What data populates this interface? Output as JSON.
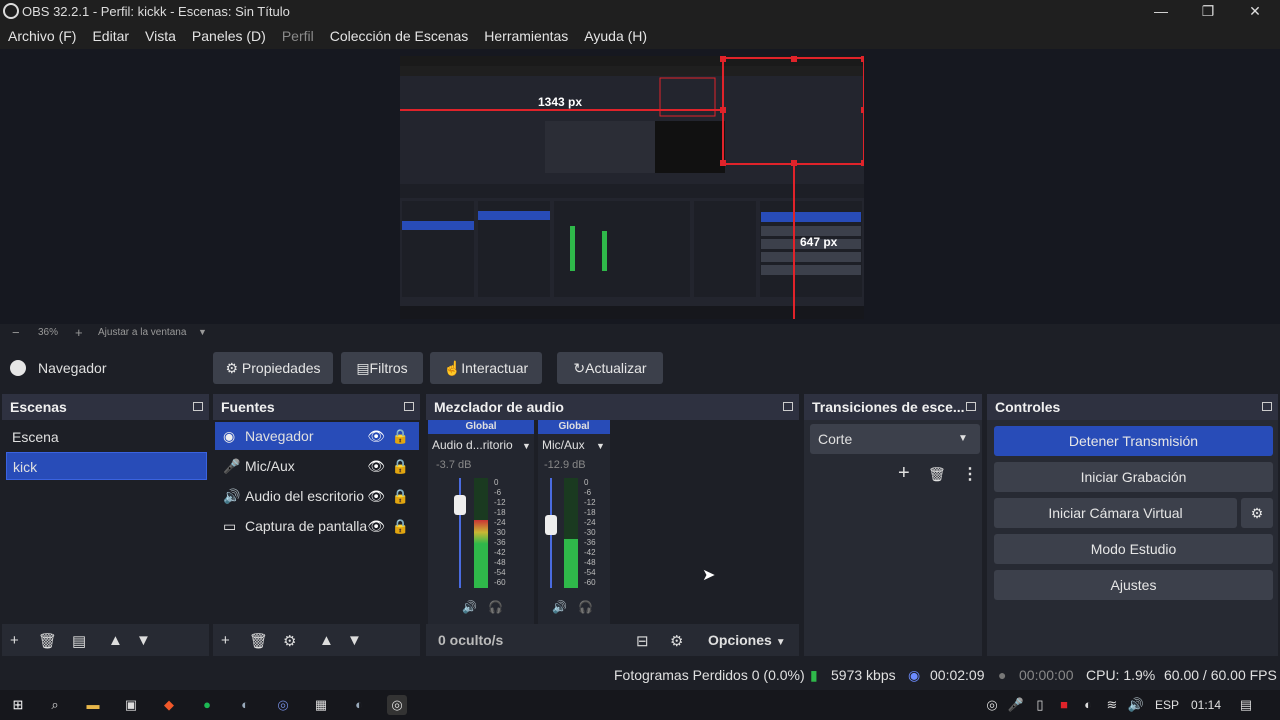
{
  "window": {
    "title": "OBS 32.2.1 - Perfil: kickk - Escenas: Sin Título"
  },
  "menu": [
    "Archivo (F)",
    "Editar",
    "Vista",
    "Paneles (D)",
    "Perfil",
    "Colección de Escenas",
    "Herramientas",
    "Ayuda (H)"
  ],
  "preview": {
    "zoom": "36%",
    "fit_label": "Ajustar a la ventana",
    "width_label": "1343 px",
    "height_label": "647 px"
  },
  "context": {
    "source_name": "Navegador",
    "buttons": {
      "properties": "Propiedades",
      "filters": "Filtros",
      "interact": "Interactuar",
      "refresh": "Actualizar"
    }
  },
  "scenes": {
    "title": "Escenas",
    "items": [
      "Escena",
      "kick"
    ]
  },
  "sources": {
    "title": "Fuentes",
    "items": [
      {
        "name": "Navegador",
        "icon": "globe-icon"
      },
      {
        "name": "Mic/Aux",
        "icon": "microphone-icon"
      },
      {
        "name": "Audio del escritorio",
        "icon": "speaker-icon"
      },
      {
        "name": "Captura de pantalla",
        "icon": "monitor-icon"
      }
    ]
  },
  "mixer": {
    "title": "Mezclador de audio",
    "channels": [
      {
        "tag": "Global",
        "name": "Audio d...ritorio",
        "db": "-3.7 dB",
        "level": 0.62,
        "fader": 0.75
      },
      {
        "tag": "Global",
        "name": "Mic/Aux",
        "db": "-12.9 dB",
        "level": 0.45,
        "fader": 0.55
      }
    ],
    "scale": [
      "0",
      "-6",
      "-12",
      "-18",
      "-24",
      "-30",
      "-36",
      "-42",
      "-48",
      "-54",
      "-60"
    ],
    "hidden": "0 oculto/s",
    "options": "Opciones"
  },
  "transitions": {
    "title": "Transiciones de esce...",
    "selected": "Corte"
  },
  "controls": {
    "title": "Controles",
    "stop_stream": "Detener Transmisión",
    "start_recording": "Iniciar Grabación",
    "start_virtual_cam": "Iniciar Cámara Virtual",
    "studio_mode": "Modo Estudio",
    "settings": "Ajustes"
  },
  "status": {
    "dropped": "Fotogramas Perdidos 0 (0.0%)",
    "bitrate": "5973 kbps",
    "stream_time": "00:02:09",
    "rec_time": "00:00:00",
    "cpu": "CPU: 1.9%",
    "fps": "60.00 / 60.00 FPS"
  },
  "taskbar": {
    "lang": "ESP",
    "time": "01:14"
  },
  "colors": {
    "accent": "#284cb8",
    "panel": "#272a33",
    "bg": "#1d1f26",
    "red": "#e0232a",
    "meter_green": "#2fb84a"
  }
}
